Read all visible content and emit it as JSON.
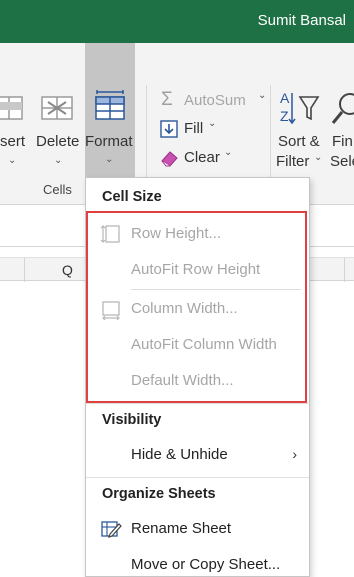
{
  "titlebar": {
    "user_name": "Sumit Bansal"
  },
  "ribbon": {
    "insert_label": "sert",
    "delete_label": "Delete",
    "format_label": "Format",
    "cells_group_label": "Cells",
    "autosum_label": "AutoSum",
    "fill_label": "Fill",
    "clear_label": "Clear",
    "sort_filter_label_1": "Sort &",
    "sort_filter_label_2": "Filter",
    "find_select_label_1": "Fin",
    "find_select_label_2": "Sele"
  },
  "sheet": {
    "column_q": "Q"
  },
  "format_menu": {
    "section_cell_size": "Cell Size",
    "row_height": "Row Height...",
    "autofit_row_height": "AutoFit Row Height",
    "column_width": "Column Width...",
    "autofit_column_width": "AutoFit Column Width",
    "default_width": "Default Width...",
    "section_visibility": "Visibility",
    "hide_unhide": "Hide & Unhide",
    "section_organize": "Organize Sheets",
    "rename_sheet": "Rename Sheet",
    "move_copy_sheet": "Move or Copy Sheet..."
  },
  "colors": {
    "title_green": "#1e7145",
    "highlight_red": "#e04040",
    "disabled_gray": "#a6a6a6"
  }
}
